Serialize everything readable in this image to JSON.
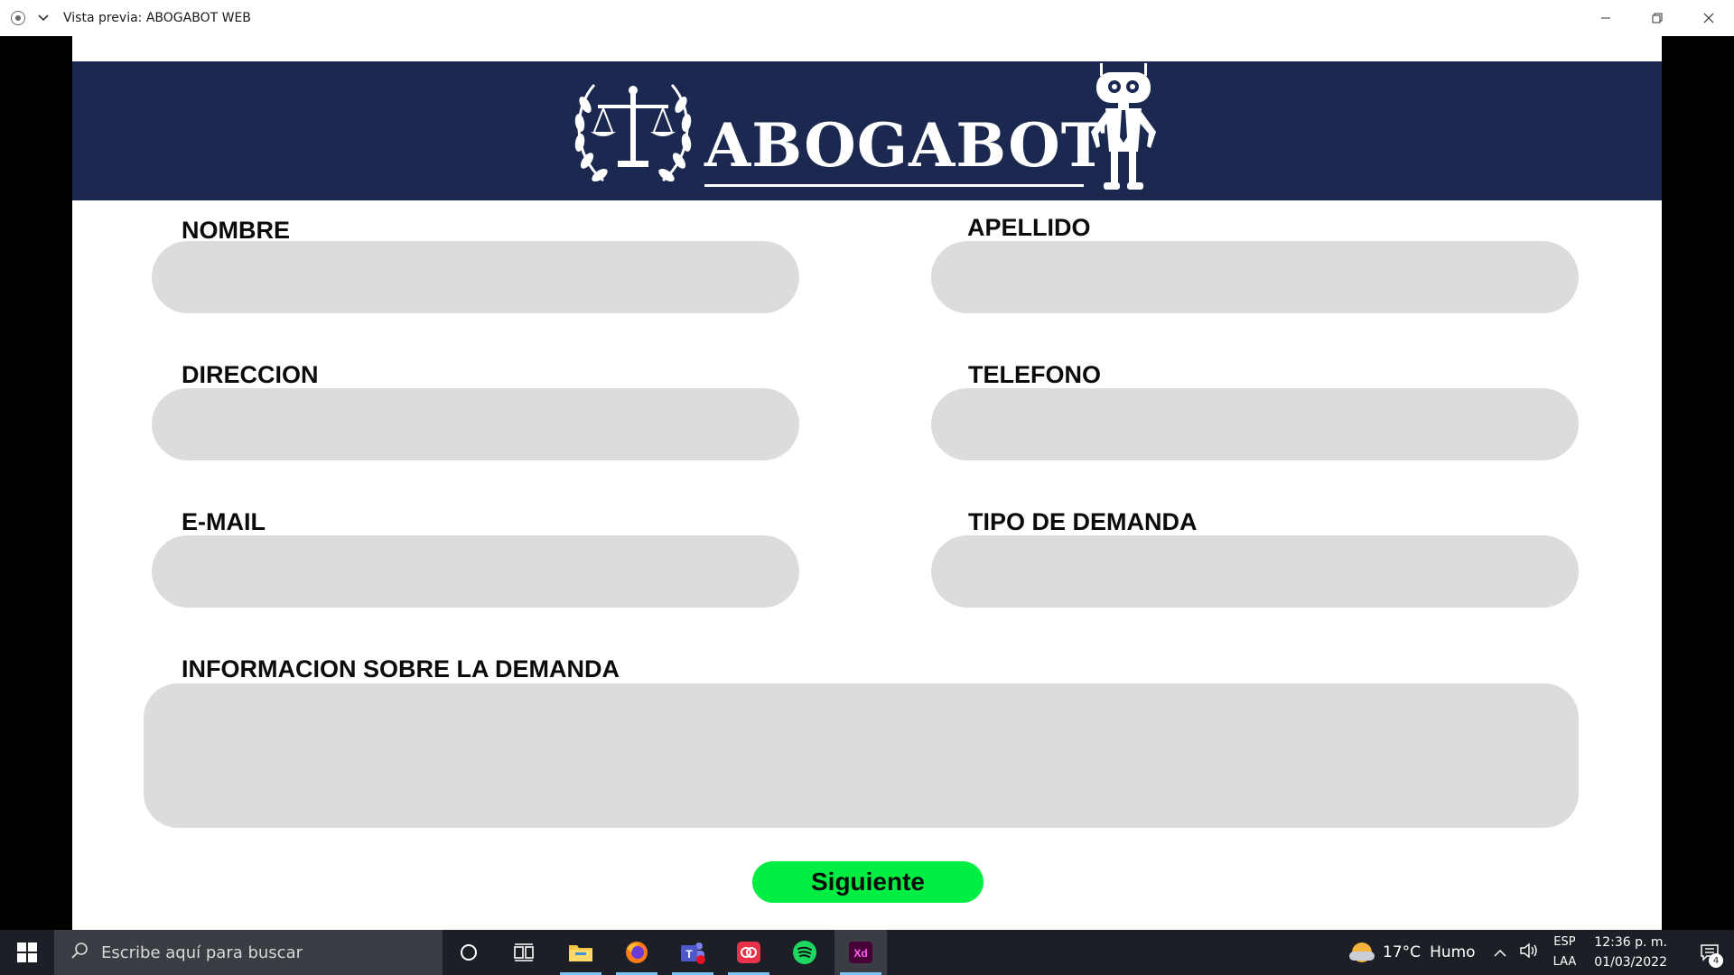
{
  "window": {
    "title": "Vista previa: ABOGABOT WEB"
  },
  "header": {
    "brand": "ABOGABOT",
    "bg_color": "#1b2850"
  },
  "form": {
    "nombre_label": "NOMBRE",
    "apellido_label": "APELLIDO",
    "direccion_label": "DIRECCION",
    "telefono_label": "TELEFONO",
    "email_label": "E-MAIL",
    "tipo_demanda_label": "TIPO DE DEMANDA",
    "informacion_label": "INFORMACION SOBRE LA DEMANDA",
    "nombre_value": "",
    "apellido_value": "",
    "direccion_value": "",
    "telefono_value": "",
    "email_value": "",
    "tipo_demanda_value": "",
    "informacion_value": "",
    "input_color": "#dddcdd",
    "next_button_label": "Siguiente",
    "next_button_color": "#00ee44"
  },
  "taskbar": {
    "search_placeholder": "Escribe aquí para buscar",
    "apps": [
      "cortana-icon",
      "task-view-icon",
      "file-explorer-icon",
      "firefox-icon",
      "teams-icon",
      "creative-cloud-icon",
      "spotify-icon",
      "adobe-xd-icon"
    ],
    "xd_label": "Xd",
    "teams_label": "T",
    "weather_temp": "17°C",
    "weather_desc": "Humo",
    "lang_top": "ESP",
    "lang_bottom": "LAA",
    "time": "12:36 p. m.",
    "date": "01/03/2022",
    "notifications_count": "4"
  }
}
